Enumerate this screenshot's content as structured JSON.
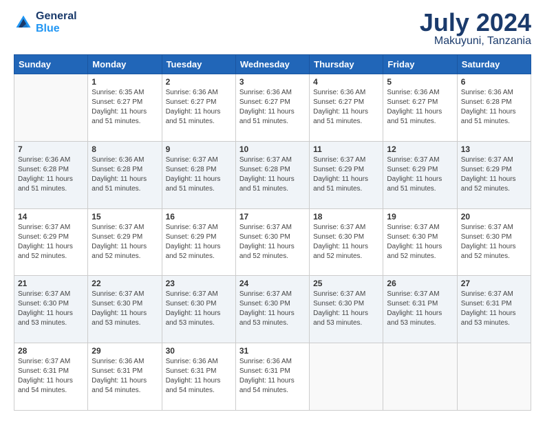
{
  "header": {
    "logo_line1": "General",
    "logo_line2": "Blue",
    "month": "July 2024",
    "location": "Makuyuni, Tanzania"
  },
  "days_of_week": [
    "Sunday",
    "Monday",
    "Tuesday",
    "Wednesday",
    "Thursday",
    "Friday",
    "Saturday"
  ],
  "weeks": [
    [
      {
        "day": "",
        "info": ""
      },
      {
        "day": "1",
        "info": "Sunrise: 6:35 AM\nSunset: 6:27 PM\nDaylight: 11 hours\nand 51 minutes."
      },
      {
        "day": "2",
        "info": "Sunrise: 6:36 AM\nSunset: 6:27 PM\nDaylight: 11 hours\nand 51 minutes."
      },
      {
        "day": "3",
        "info": "Sunrise: 6:36 AM\nSunset: 6:27 PM\nDaylight: 11 hours\nand 51 minutes."
      },
      {
        "day": "4",
        "info": "Sunrise: 6:36 AM\nSunset: 6:27 PM\nDaylight: 11 hours\nand 51 minutes."
      },
      {
        "day": "5",
        "info": "Sunrise: 6:36 AM\nSunset: 6:27 PM\nDaylight: 11 hours\nand 51 minutes."
      },
      {
        "day": "6",
        "info": "Sunrise: 6:36 AM\nSunset: 6:28 PM\nDaylight: 11 hours\nand 51 minutes."
      }
    ],
    [
      {
        "day": "7",
        "info": "Sunrise: 6:36 AM\nSunset: 6:28 PM\nDaylight: 11 hours\nand 51 minutes."
      },
      {
        "day": "8",
        "info": "Sunrise: 6:36 AM\nSunset: 6:28 PM\nDaylight: 11 hours\nand 51 minutes."
      },
      {
        "day": "9",
        "info": "Sunrise: 6:37 AM\nSunset: 6:28 PM\nDaylight: 11 hours\nand 51 minutes."
      },
      {
        "day": "10",
        "info": "Sunrise: 6:37 AM\nSunset: 6:28 PM\nDaylight: 11 hours\nand 51 minutes."
      },
      {
        "day": "11",
        "info": "Sunrise: 6:37 AM\nSunset: 6:29 PM\nDaylight: 11 hours\nand 51 minutes."
      },
      {
        "day": "12",
        "info": "Sunrise: 6:37 AM\nSunset: 6:29 PM\nDaylight: 11 hours\nand 51 minutes."
      },
      {
        "day": "13",
        "info": "Sunrise: 6:37 AM\nSunset: 6:29 PM\nDaylight: 11 hours\nand 52 minutes."
      }
    ],
    [
      {
        "day": "14",
        "info": "Sunrise: 6:37 AM\nSunset: 6:29 PM\nDaylight: 11 hours\nand 52 minutes."
      },
      {
        "day": "15",
        "info": "Sunrise: 6:37 AM\nSunset: 6:29 PM\nDaylight: 11 hours\nand 52 minutes."
      },
      {
        "day": "16",
        "info": "Sunrise: 6:37 AM\nSunset: 6:29 PM\nDaylight: 11 hours\nand 52 minutes."
      },
      {
        "day": "17",
        "info": "Sunrise: 6:37 AM\nSunset: 6:30 PM\nDaylight: 11 hours\nand 52 minutes."
      },
      {
        "day": "18",
        "info": "Sunrise: 6:37 AM\nSunset: 6:30 PM\nDaylight: 11 hours\nand 52 minutes."
      },
      {
        "day": "19",
        "info": "Sunrise: 6:37 AM\nSunset: 6:30 PM\nDaylight: 11 hours\nand 52 minutes."
      },
      {
        "day": "20",
        "info": "Sunrise: 6:37 AM\nSunset: 6:30 PM\nDaylight: 11 hours\nand 52 minutes."
      }
    ],
    [
      {
        "day": "21",
        "info": "Sunrise: 6:37 AM\nSunset: 6:30 PM\nDaylight: 11 hours\nand 53 minutes."
      },
      {
        "day": "22",
        "info": "Sunrise: 6:37 AM\nSunset: 6:30 PM\nDaylight: 11 hours\nand 53 minutes."
      },
      {
        "day": "23",
        "info": "Sunrise: 6:37 AM\nSunset: 6:30 PM\nDaylight: 11 hours\nand 53 minutes."
      },
      {
        "day": "24",
        "info": "Sunrise: 6:37 AM\nSunset: 6:30 PM\nDaylight: 11 hours\nand 53 minutes."
      },
      {
        "day": "25",
        "info": "Sunrise: 6:37 AM\nSunset: 6:30 PM\nDaylight: 11 hours\nand 53 minutes."
      },
      {
        "day": "26",
        "info": "Sunrise: 6:37 AM\nSunset: 6:31 PM\nDaylight: 11 hours\nand 53 minutes."
      },
      {
        "day": "27",
        "info": "Sunrise: 6:37 AM\nSunset: 6:31 PM\nDaylight: 11 hours\nand 53 minutes."
      }
    ],
    [
      {
        "day": "28",
        "info": "Sunrise: 6:37 AM\nSunset: 6:31 PM\nDaylight: 11 hours\nand 54 minutes."
      },
      {
        "day": "29",
        "info": "Sunrise: 6:36 AM\nSunset: 6:31 PM\nDaylight: 11 hours\nand 54 minutes."
      },
      {
        "day": "30",
        "info": "Sunrise: 6:36 AM\nSunset: 6:31 PM\nDaylight: 11 hours\nand 54 minutes."
      },
      {
        "day": "31",
        "info": "Sunrise: 6:36 AM\nSunset: 6:31 PM\nDaylight: 11 hours\nand 54 minutes."
      },
      {
        "day": "",
        "info": ""
      },
      {
        "day": "",
        "info": ""
      },
      {
        "day": "",
        "info": ""
      }
    ]
  ]
}
